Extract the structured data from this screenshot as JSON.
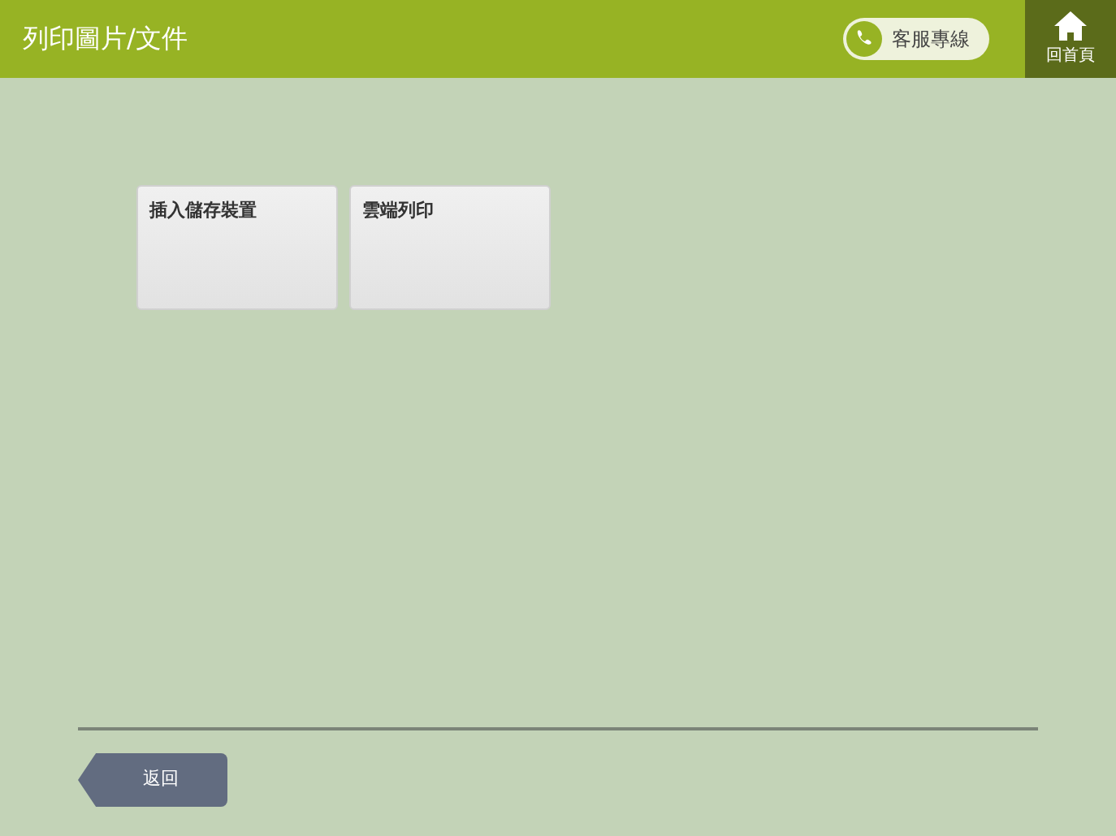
{
  "header": {
    "title": "列印圖片/文件",
    "support_button": "客服專線",
    "home_button": "回首頁"
  },
  "options": [
    {
      "label": "插入儲存裝置"
    },
    {
      "label": "雲端列印"
    }
  ],
  "back_button": "返回"
}
